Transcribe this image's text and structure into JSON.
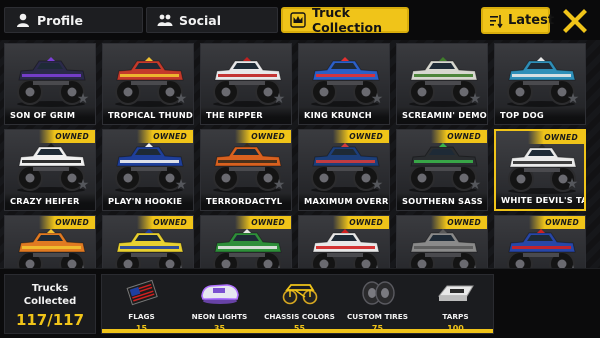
{
  "tabs": {
    "profile": "Profile",
    "social": "Social",
    "trucks": "Truck Collection"
  },
  "sort_label": "Latest",
  "ribbon_text": "OWNED",
  "accent": "#f0c419",
  "trucks": [
    {
      "name": "SON OF GRIM",
      "owned": false,
      "body": "#2b2a4a",
      "accent": "#7b3fd6"
    },
    {
      "name": "TROPICAL THUNDER",
      "owned": false,
      "body": "#c43a2b",
      "accent": "#f2c230"
    },
    {
      "name": "THE RIPPER",
      "owned": false,
      "body": "#e8e8ea",
      "accent": "#c02020"
    },
    {
      "name": "KING KRUNCH",
      "owned": false,
      "body": "#2c5fc7",
      "accent": "#e53030"
    },
    {
      "name": "SCREAMIN' DEMON",
      "owned": false,
      "body": "#d8d8d0",
      "accent": "#3f7d2a"
    },
    {
      "name": "TOP DOG",
      "owned": false,
      "body": "#2f8fb8",
      "accent": "#e8e8e8"
    },
    {
      "name": "CRAZY HEIFER",
      "owned": true,
      "body": "#f0f0f0",
      "accent": "#1a1a1a"
    },
    {
      "name": "PLAY'N HOOKIE",
      "owned": true,
      "body": "#1f3f9a",
      "accent": "#f2f2f2"
    },
    {
      "name": "TERRORDACTYL",
      "owned": true,
      "body": "#d9611f",
      "accent": "#3a2b1a"
    },
    {
      "name": "MAXIMUM OVERRIDE",
      "owned": true,
      "body": "#1d3f7a",
      "accent": "#d33b3b"
    },
    {
      "name": "SOUTHERN SASS",
      "owned": true,
      "body": "#2a2d30",
      "accent": "#3ab34a"
    },
    {
      "name": "WHITE DEVIL'S TAXI",
      "owned": true,
      "body": "#eaeaea",
      "accent": "#2a2a2a",
      "selected": true
    },
    {
      "name": "",
      "owned": true,
      "body": "#e07a22",
      "accent": "#f2c230"
    },
    {
      "name": "",
      "owned": true,
      "body": "#e8d030",
      "accent": "#1f3fa0"
    },
    {
      "name": "",
      "owned": true,
      "body": "#2f8f3a",
      "accent": "#e8e8e8"
    },
    {
      "name": "",
      "owned": true,
      "body": "#e8e8e8",
      "accent": "#d02020"
    },
    {
      "name": "",
      "owned": true,
      "body": "#8a8a8a",
      "accent": "#5a5a5a"
    },
    {
      "name": "",
      "owned": true,
      "body": "#2847a8",
      "accent": "#d02020"
    }
  ],
  "collection": {
    "label_line1": "Trucks",
    "label_line2": "Collected",
    "count": "117/117"
  },
  "rewards": [
    {
      "label": "FLAGS",
      "value": "15",
      "icon": "flag-icon"
    },
    {
      "label": "NEON LIGHTS",
      "value": "35",
      "icon": "neon-lights-icon"
    },
    {
      "label": "CHASSIS COLORS",
      "value": "55",
      "icon": "chassis-icon"
    },
    {
      "label": "CUSTOM TIRES",
      "value": "75",
      "icon": "tires-icon"
    },
    {
      "label": "TARPS",
      "value": "100",
      "icon": "tarp-icon"
    }
  ],
  "progress": 1.0
}
